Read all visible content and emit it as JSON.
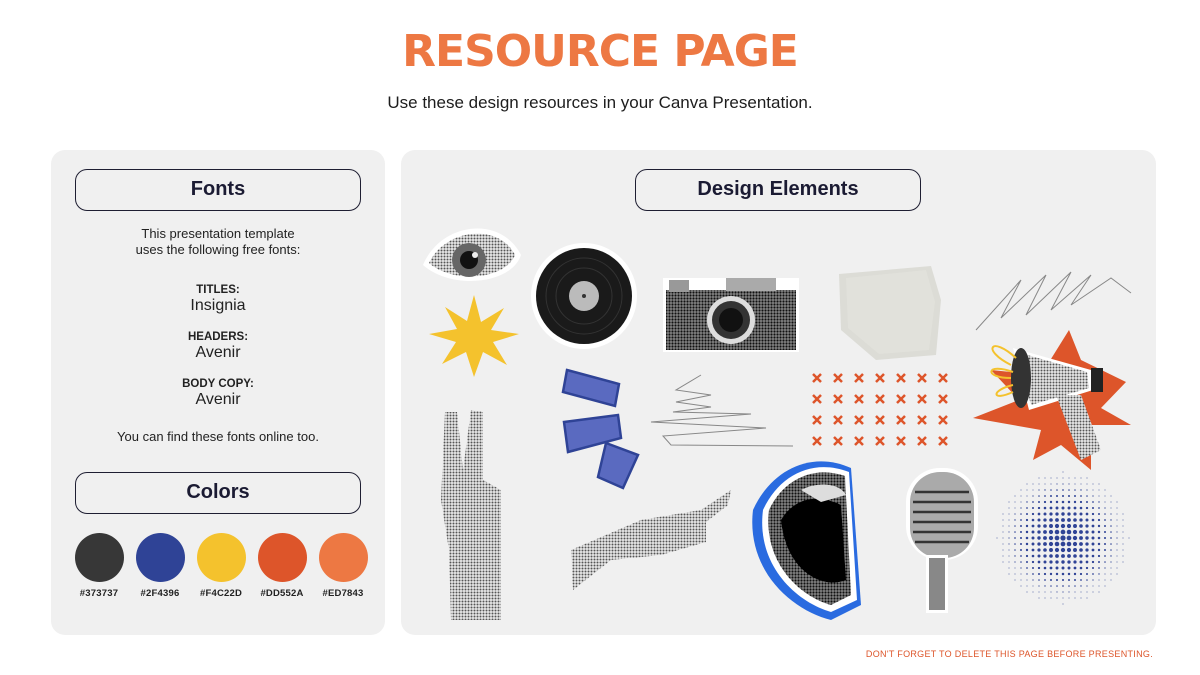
{
  "header": {
    "title": "RESOURCE PAGE",
    "subtitle": "Use these design resources in your Canva Presentation."
  },
  "fonts_panel": {
    "heading": "Fonts",
    "intro_line1": "This presentation template",
    "intro_line2": "uses the following free fonts:",
    "entries": [
      {
        "label": "TITLES:",
        "font": "Insignia"
      },
      {
        "label": "HEADERS:",
        "font": "Avenir"
      },
      {
        "label": "BODY COPY:",
        "font": "Avenir"
      }
    ],
    "outro": "You can find these fonts online too."
  },
  "colors_panel": {
    "heading": "Colors",
    "swatches": [
      {
        "hex": "#373737",
        "label": "#373737"
      },
      {
        "hex": "#2F4396",
        "label": "#2F4396"
      },
      {
        "hex": "#F4C22D",
        "label": "#F4C22D"
      },
      {
        "hex": "#DD552A",
        "label": "#DD552A"
      },
      {
        "hex": "#ED7843",
        "label": "#ED7843"
      }
    ]
  },
  "design_panel": {
    "heading": "Design Elements",
    "elements": [
      "eye",
      "vinyl-record",
      "camera",
      "paper-texture",
      "scribble",
      "starburst-yellow",
      "blue-strokes",
      "zigzag-scribble",
      "x-pattern",
      "megaphone",
      "peace-hand",
      "pointing-hand",
      "mouth",
      "microphone",
      "halftone-dots"
    ]
  },
  "footer": {
    "note": "DON'T FORGET TO DELETE THIS PAGE BEFORE PRESENTING."
  },
  "colors": {
    "accent": "#ED7843",
    "dark": "#373737",
    "blue": "#2F4396",
    "yellow": "#F4C22D",
    "red_orange": "#DD552A"
  }
}
